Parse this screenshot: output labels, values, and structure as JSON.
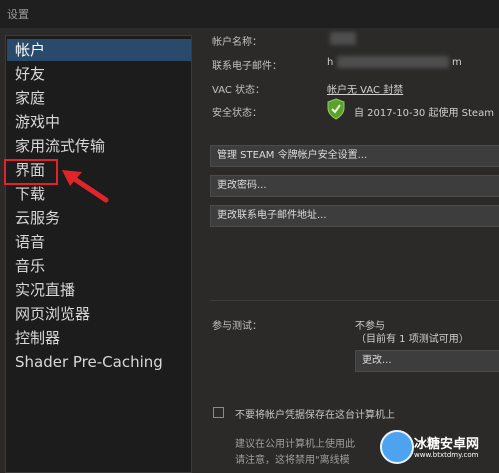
{
  "window": {
    "title": "设置"
  },
  "sidebar": {
    "items": [
      {
        "label": "帐户",
        "selected": true
      },
      {
        "label": "好友"
      },
      {
        "label": "家庭"
      },
      {
        "label": "游戏中"
      },
      {
        "label": "家用流式传输"
      },
      {
        "label": "界面",
        "highlighted": true
      },
      {
        "label": "下载"
      },
      {
        "label": "云服务"
      },
      {
        "label": "语音"
      },
      {
        "label": "音乐"
      },
      {
        "label": "实况直播"
      },
      {
        "label": "网页浏览器"
      },
      {
        "label": "控制器"
      },
      {
        "label": "Shader Pre-Caching"
      }
    ]
  },
  "account": {
    "name_label": "帐户名称：",
    "email_label": "联系电子邮件：",
    "email_prefix": "h",
    "email_suffix": "m",
    "vac_label": "VAC 状态：",
    "vac_value": "帐户无 VAC 封禁",
    "security_label": "安全状态：",
    "security_value": "自 2017-10-30 起使用 Steam"
  },
  "buttons": {
    "manage_guard": "管理 STEAM 令牌帐户安全设置...",
    "change_password": "更改密码...",
    "change_email": "更改联系电子邮件地址..."
  },
  "beta": {
    "label": "参与测试：",
    "value": "不参与",
    "note": "（目前有 1 项测试可用）",
    "change_button": "更改..."
  },
  "credentials": {
    "checkbox_label": "不要将帐户凭据保存在这台计算机上",
    "checked": false,
    "note_line1": "建议在公用计算机上使用此",
    "note_line2": "请注意，这将禁用\"离线模"
  },
  "watermark": {
    "name": "冰糖安卓网",
    "url": "www.btxtdmy.com"
  },
  "colors": {
    "selected": "#2a4a6c",
    "highlight_box": "#e0242a",
    "shield": "#5ba22c"
  }
}
